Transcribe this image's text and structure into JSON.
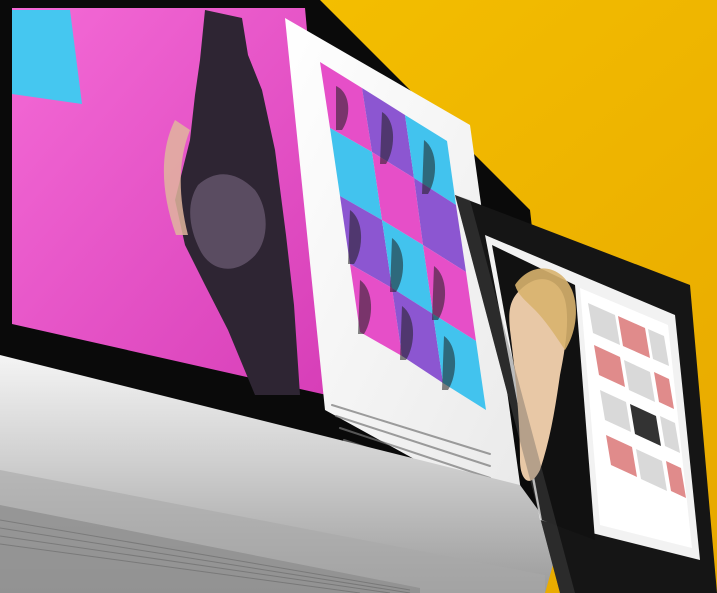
{
  "scene": {
    "description_hidden": "",
    "background_color": "#F2B400",
    "monitor_frame_color": "#0b0b0b",
    "monitor_silver_color": "#d7d7d7",
    "screen_left_magenta": "#E64FC8",
    "screen_left_cyan": "#42C3EE",
    "screen_right_paper": "#f7f7f7",
    "tablet_frame_color": "#1a1a1a"
  },
  "icons": {
    "main_monitor": "monitor-icon",
    "tablet": "tablet-icon"
  }
}
